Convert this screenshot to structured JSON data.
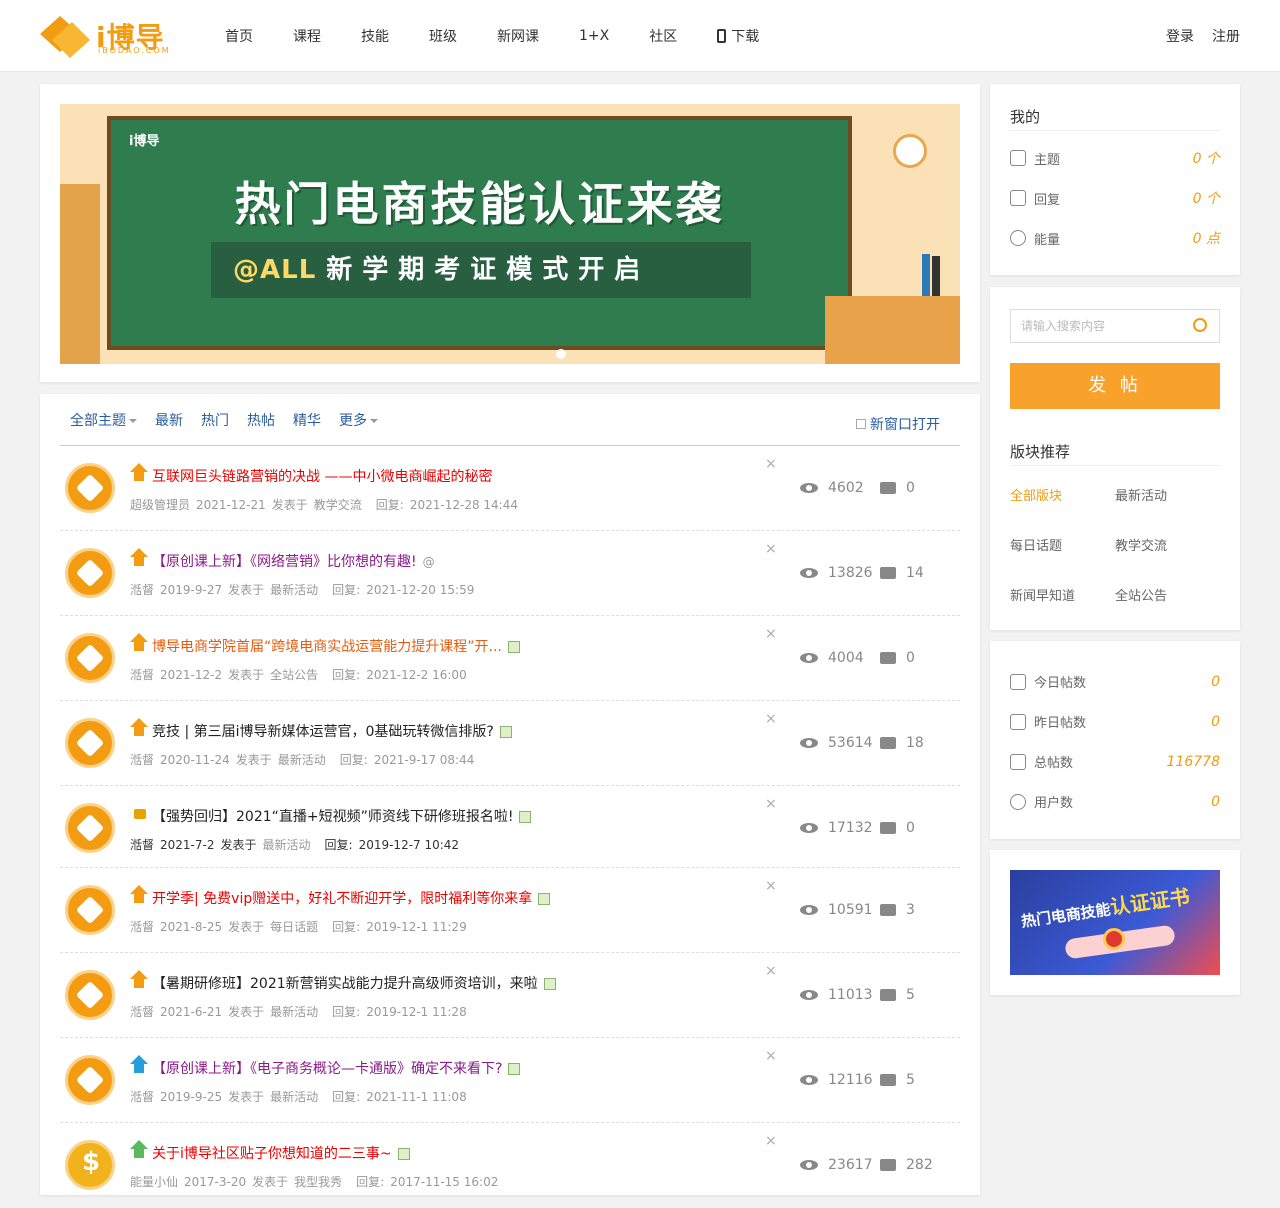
{
  "header": {
    "logo_text": "i博导",
    "logo_sub": "iBODAO.COM",
    "nav": [
      "首页",
      "课程",
      "技能",
      "班级",
      "新网课",
      "1+X",
      "社区",
      "下载"
    ],
    "login": "登录",
    "register": "注册"
  },
  "banner": {
    "title": "热门电商技能认证来袭",
    "strip_at": "@ALL",
    "strip_text": "新学期考证模式开启",
    "logo": "i博导"
  },
  "list": {
    "tabs": [
      "全部主题",
      "最新",
      "热门",
      "热帖",
      "精华",
      "更多"
    ],
    "new_window": "新窗口打开",
    "threads": [
      {
        "title": "互联网巨头链路营销的决战 ——中小微电商崛起的秘密",
        "author": "超级管理员",
        "date": "2021-12-21",
        "posted_in": "发表于",
        "forum": "教学交流",
        "reply_label": "回复:",
        "last_reply": "2021-12-28 14:44",
        "views": "4602",
        "replies": "0",
        "close": "×"
      },
      {
        "title": "【原创课上新】《网络营销》比你想的有趣!",
        "author": "湉督",
        "date": "2019-9-27",
        "posted_in": "发表于",
        "forum": "最新活动",
        "reply_label": "回复:",
        "last_reply": "2021-12-20 15:59",
        "views": "13826",
        "replies": "14",
        "close": "×"
      },
      {
        "title": "博导电商学院首届“跨境电商实战运营能力提升课程”开...",
        "author": "湉督",
        "date": "2021-12-2",
        "posted_in": "发表于",
        "forum": "全站公告",
        "reply_label": "回复:",
        "last_reply": "2021-12-2 16:00",
        "views": "4004",
        "replies": "0",
        "close": "×"
      },
      {
        "title": "竞技 | 第三届i博导新媒体运营官，0基础玩转微信排版?",
        "author": "湉督",
        "date": "2020-11-24",
        "posted_in": "发表于",
        "forum": "最新活动",
        "reply_label": "回复:",
        "last_reply": "2021-9-17 08:44",
        "views": "53614",
        "replies": "18",
        "close": "×"
      },
      {
        "title": "【强势回归】2021“直播+短视频”师资线下研修班报名啦!",
        "author": "湉督",
        "date": "2021-7-2",
        "posted_in": "发表于",
        "forum": "最新活动",
        "reply_label": "回复:",
        "last_reply": "2019-12-7 10:42",
        "views": "17132",
        "replies": "0",
        "close": "×"
      },
      {
        "title": "开学季| 免费vip赠送中，好礼不断迎开学，限时福利等你来拿",
        "author": "湉督",
        "date": "2021-8-25",
        "posted_in": "发表于",
        "forum": "每日话题",
        "reply_label": "回复:",
        "last_reply": "2019-12-1 11:29",
        "views": "10591",
        "replies": "3",
        "close": "×"
      },
      {
        "title": "【暑期研修班】2021新营销实战能力提升高级师资培训，来啦",
        "author": "湉督",
        "date": "2021-6-21",
        "posted_in": "发表于",
        "forum": "最新活动",
        "reply_label": "回复:",
        "last_reply": "2019-12-1 11:28",
        "views": "11013",
        "replies": "5",
        "close": "×"
      },
      {
        "title": "【原创课上新】《电子商务概论—卡通版》确定不来看下?",
        "author": "湉督",
        "date": "2019-9-25",
        "posted_in": "发表于",
        "forum": "最新活动",
        "reply_label": "回复:",
        "last_reply": "2021-11-1 11:08",
        "views": "12116",
        "replies": "5",
        "close": "×"
      },
      {
        "title": "关于i博导社区贴子你想知道的二三事~",
        "author": "能量小仙",
        "date": "2017-3-20",
        "posted_in": "发表于",
        "forum": "我型我秀",
        "reply_label": "回复:",
        "last_reply": "2017-11-15 16:02",
        "views": "23617",
        "replies": "282",
        "close": "×"
      }
    ]
  },
  "mine": {
    "title": "我的",
    "rows": [
      {
        "label": "主题",
        "value": "0 个"
      },
      {
        "label": "回复",
        "value": "0 个"
      },
      {
        "label": "能量",
        "value": "0 点"
      }
    ]
  },
  "search": {
    "placeholder": "请输入搜索内容",
    "post_button": "发 帖"
  },
  "boards": {
    "title": "版块推荐",
    "items": [
      "全部版块",
      "最新活动",
      "每日话题",
      "教学交流",
      "新闻早知道",
      "全站公告"
    ]
  },
  "stats": {
    "rows": [
      {
        "label": "今日帖数",
        "value": "0"
      },
      {
        "label": "昨日帖数",
        "value": "0"
      },
      {
        "label": "总帖数",
        "value": "116778"
      },
      {
        "label": "用户数",
        "value": "0"
      }
    ]
  },
  "ad": {
    "text1": "热门电商技能",
    "text2": "认证证书"
  },
  "colors": {
    "accent": "#f39c12",
    "link": "#2a5d9f",
    "button": "#f8a22c"
  }
}
